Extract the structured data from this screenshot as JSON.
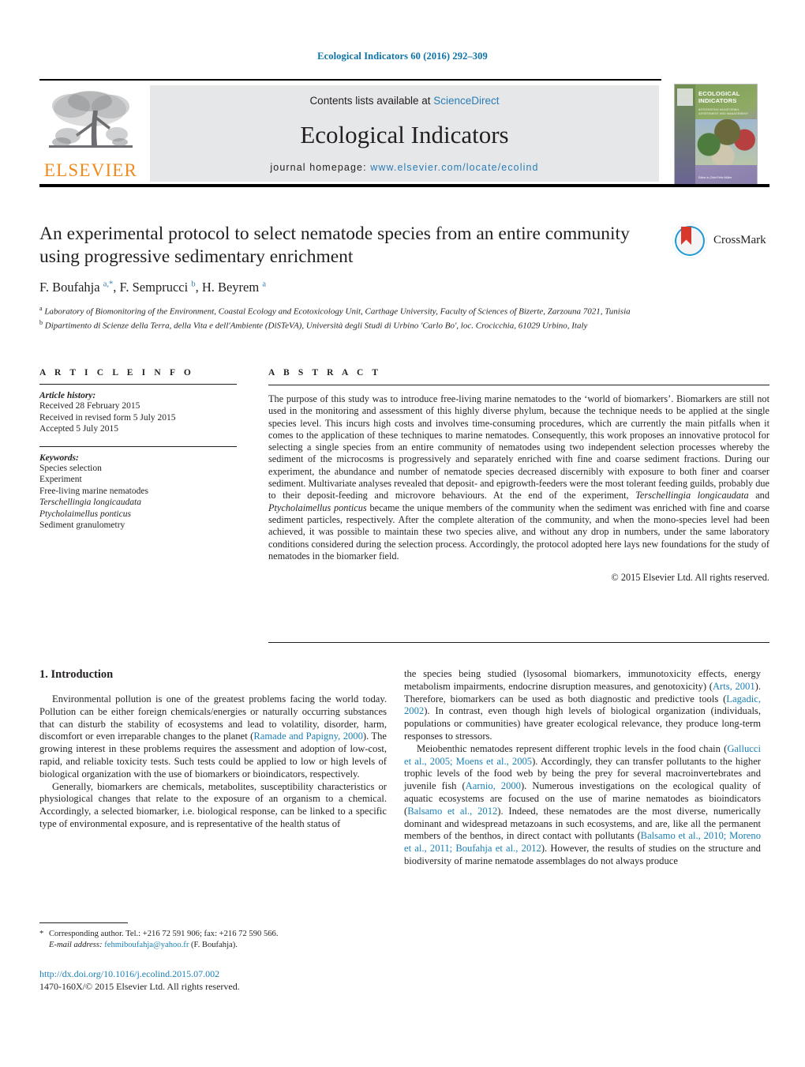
{
  "running_head": "Ecological Indicators 60 (2016) 292–309",
  "masthead": {
    "contents_prefix": "Contents lists available at ",
    "contents_link": "ScienceDirect",
    "journal_name": "Ecological Indicators",
    "homepage_prefix": "journal homepage: ",
    "homepage_url": "www.elsevier.com/locate/ecolind",
    "publisher_wordmark": "ELSEVIER",
    "cover": {
      "title": "ECOLOGICAL INDICATORS",
      "subtitle": "INTEGRATING MONITORING, ASSESSMENT AND MANAGEMENT",
      "footer": "Editor-in-Chief\nFelix Müller"
    }
  },
  "crossmark": {
    "label": "CrossMark"
  },
  "article": {
    "title": "An experimental protocol to select nematode species from an entire community using progressive sedimentary enrichment",
    "authors_html": "F. Boufahja <sup class=\"ast\">a,*</sup>, F. Semprucci <sup>b</sup>, H. Beyrem <sup>a</sup>",
    "authors_plain": "F. Boufahja a,*, F. Semprucci b, H. Beyrem a",
    "affiliations": [
      "a Laboratory of Biomonitoring of the Environment, Coastal Ecology and Ecotoxicology Unit, Carthage University, Faculty of Sciences of Bizerte, Zarzouna 7021, Tunisia",
      "b Dipartimento di Scienze della Terra, della Vita e dell'Ambiente (DiSTeVA), Università degli Studi di Urbino 'Carlo Bo', loc. Crocicchia, 61029 Urbino, Italy"
    ]
  },
  "article_info": {
    "heading": "A R T I C L E   I N F O",
    "history_label": "Article history:",
    "history": [
      "Received 28 February 2015",
      "Received in revised form 5 July 2015",
      "Accepted 5 July 2015"
    ],
    "keywords_label": "Keywords:",
    "keywords": [
      "Species selection",
      "Experiment",
      "Free-living marine nematodes",
      "Terschellingia longicaudata",
      "Ptycholaimellus ponticus",
      "Sediment granulometry"
    ],
    "keywords_italic": [
      false,
      false,
      false,
      true,
      true,
      false
    ]
  },
  "abstract": {
    "heading": "A B S T R A C T",
    "body_html": "The purpose of this study was to introduce free-living marine nematodes to the ‘world of biomarkers’. Biomarkers are still not used in the monitoring and assessment of this highly diverse phylum, because the technique needs to be applied at the single species level. This incurs high costs and involves time-consuming procedures, which are currently the main pitfalls when it comes to the application of these techniques to marine nematodes. Consequently, this work proposes an innovative protocol for selecting a single species from an entire community of nematodes using two independent selection processes whereby the sediment of the microcosms is progressively and separately enriched with fine and coarse sediment fractions. During our experiment, the abundance and number of nematode species decreased discernibly with exposure to both finer and coarser sediment. Multivariate analyses revealed that deposit- and epigrowth-feeders were the most tolerant feeding guilds, probably due to their deposit-feeding and microvore behaviours. At the end of the experiment, <i>Terschellingia longicaudata</i> and <i>Ptycholaimellus ponticus</i> became the unique members of the community when the sediment was enriched with fine and coarse sediment particles, respectively. After the complete alteration of the community, and when the mono-species level had been achieved, it was possible to maintain these two species alive, and without any drop in numbers, under the same laboratory conditions considered during the selection process. Accordingly, the protocol adopted here lays new foundations for the study of nematodes in the biomarker field.",
    "copyright": "© 2015 Elsevier Ltd. All rights reserved."
  },
  "introduction": {
    "section_title": "1.  Introduction",
    "left_paragraphs_html": [
      "Environmental pollution is one of the greatest problems facing the world today. Pollution can be either foreign chemicals/energies or naturally occurring substances that can disturb the stability of ecosystems and lead to volatility, disorder, harm, discomfort or even irreparable changes to the planet (<a class=\"cit\" href=\"#\" data-name=\"citation-link\">Ramade and Papigny, 2000</a>). The growing interest in these problems requires the assessment and adoption of low-cost, rapid, and reliable toxicity tests. Such tests could be applied to low or high levels of biological organization with the use of biomarkers or bioindicators, respectively.",
      "Generally, biomarkers are chemicals, metabolites, susceptibility characteristics or physiological changes that relate to the exposure of an organism to a chemical. Accordingly, a selected biomarker, i.e. biological response, can be linked to a specific type of environmental exposure, and is representative of the health status of"
    ],
    "right_paragraphs_html": [
      "the species being studied (lysosomal biomarkers, immunotoxicity effects, energy metabolism impairments, endocrine disruption measures, and genotoxicity) (<a class=\"cit\" href=\"#\" data-name=\"citation-link\">Arts, 2001</a>). Therefore, biomarkers can be used as both diagnostic and predictive tools (<a class=\"cit\" href=\"#\" data-name=\"citation-link\">Lagadic, 2002</a>). In contrast, even though high levels of biological organization (individuals, populations or communities) have greater ecological relevance, they produce long-term responses to stressors.",
      "Meiobenthic nematodes represent different trophic levels in the food chain (<a class=\"cit\" href=\"#\" data-name=\"citation-link\">Gallucci et al., 2005; Moens et al., 2005</a>). Accordingly, they can transfer pollutants to the higher trophic levels of the food web by being the prey for several macroinvertebrates and juvenile fish (<a class=\"cit\" href=\"#\" data-name=\"citation-link\">Aarnio, 2000</a>). Numerous investigations on the ecological quality of aquatic ecosystems are focused on the use of marine nematodes as bioindicators (<a class=\"cit\" href=\"#\" data-name=\"citation-link\">Balsamo et al., 2012</a>). Indeed, these nematodes are the most diverse, numerically dominant and widespread metazoans in such ecosystems, and are, like all the permanent members of the benthos, in direct contact with pollutants (<a class=\"cit\" href=\"#\" data-name=\"citation-link\">Balsamo et al., 2010; Moreno et al., 2011; Boufahja et al., 2012</a>). However, the results of studies on the structure and biodiversity of marine nematode assemblages do not always produce"
    ]
  },
  "footer": {
    "corresponding_html": "<span class=\"ast\">*</span> Corresponding author. Tel.: +216 72 591 906; fax: +216 72 590 566.",
    "email_label": "E-mail address:",
    "email": "fehmiboufahja@yahoo.fr",
    "email_suffix": "(F. Boufahja).",
    "doi": "http://dx.doi.org/10.1016/j.ecolind.2015.07.002",
    "issn_line": "1470-160X/© 2015 Elsevier Ltd. All rights reserved."
  },
  "colors": {
    "link_blue": "#1b7fb5",
    "header_blue": "#0b72a8",
    "elsevier_orange": "#f08a1d",
    "masthead_grey": "#e6e7e8",
    "crossmark_blue": "#1b9ad6",
    "crossmark_red": "#d8372b"
  }
}
